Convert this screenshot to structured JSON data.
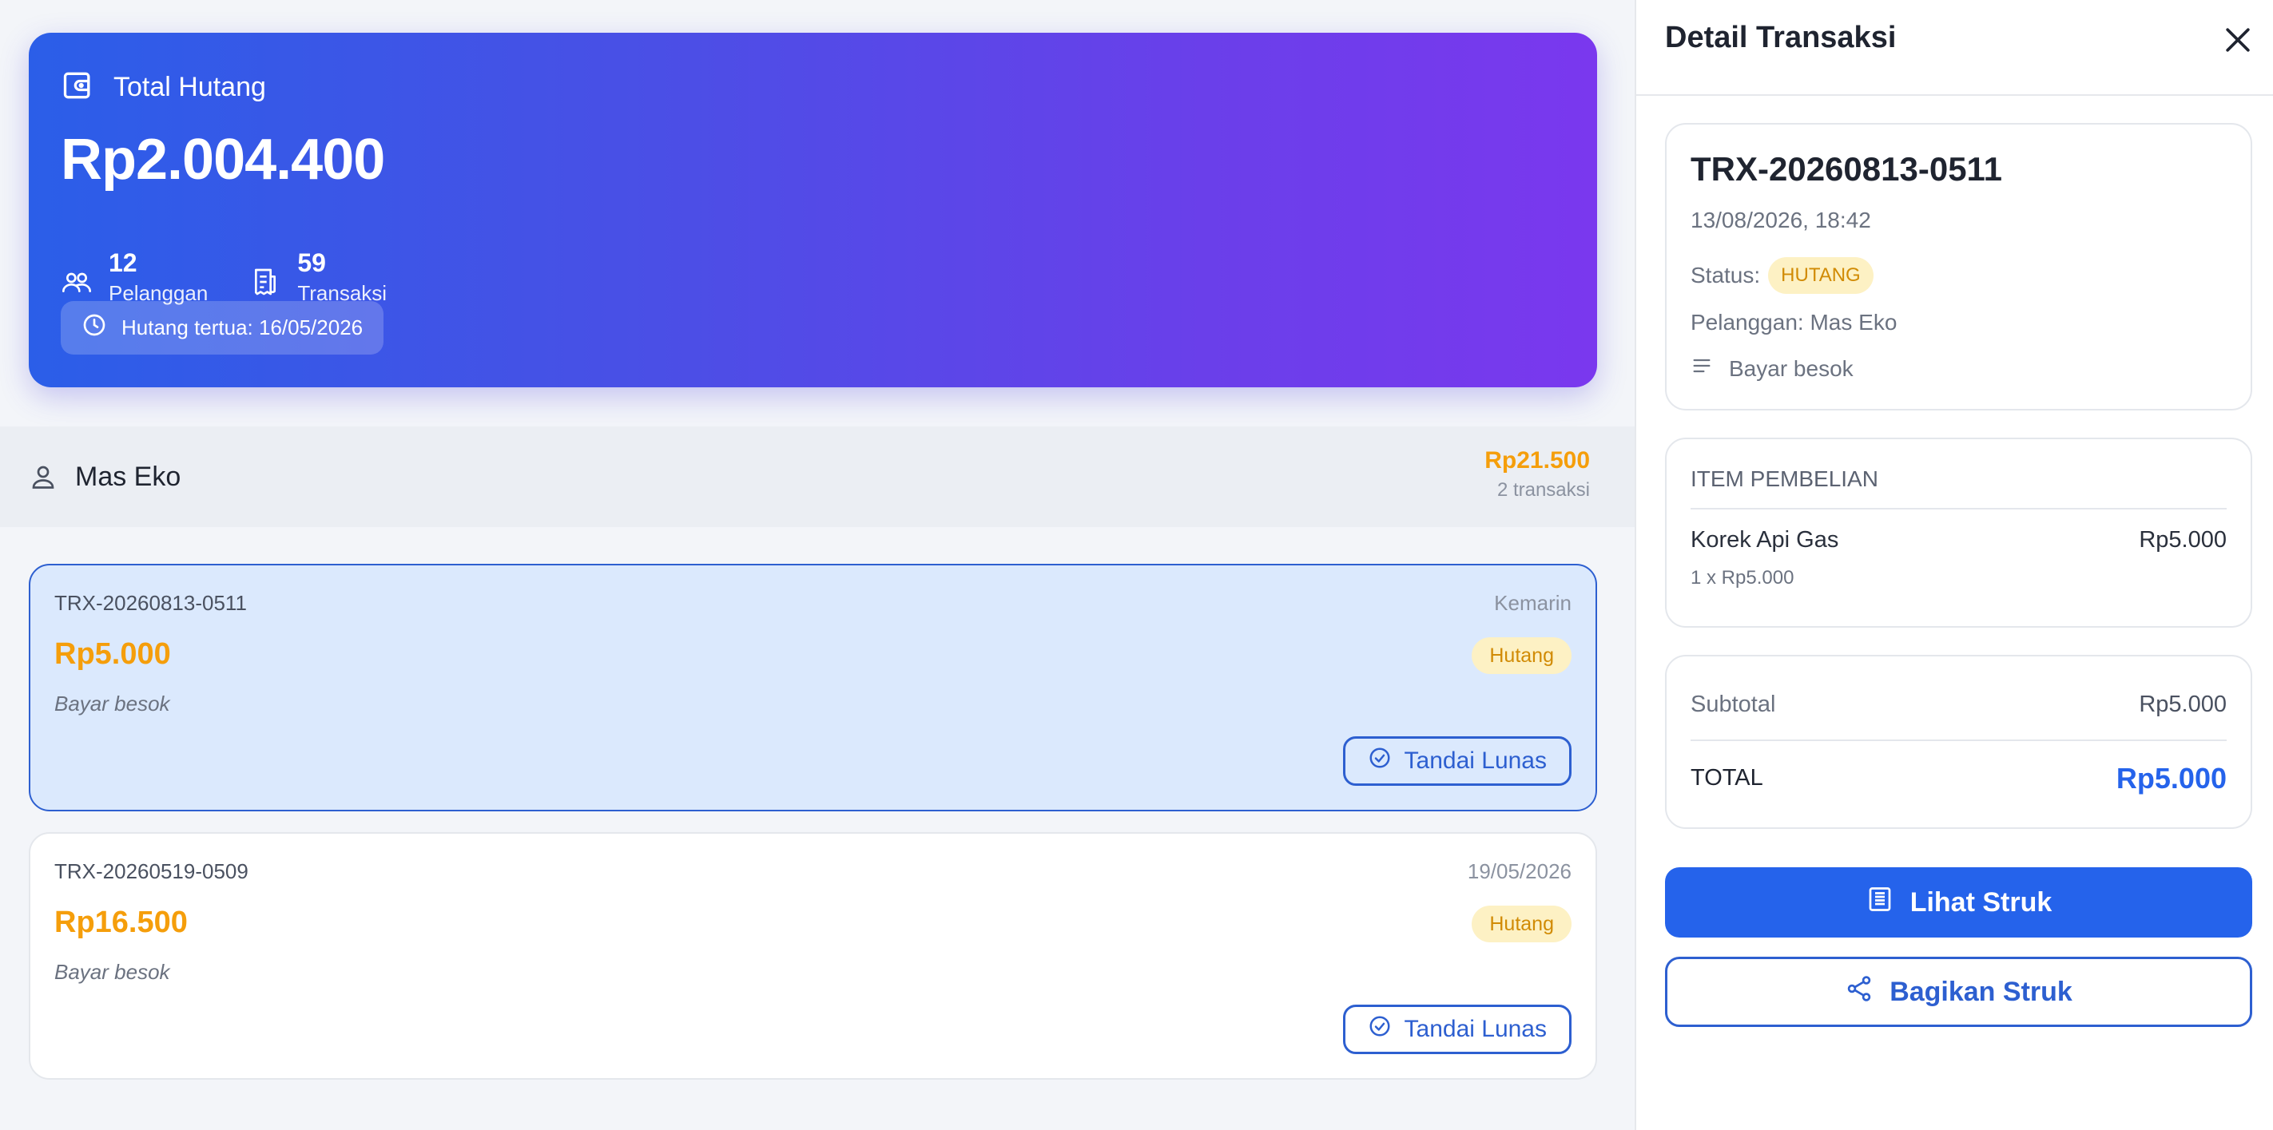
{
  "summary": {
    "title": "Total Hutang",
    "amount": "Rp2.004.400",
    "customers_count": "12",
    "customers_label": "Pelanggan",
    "transactions_count": "59",
    "transactions_label": "Transaksi",
    "oldest_debt": "Hutang tertua: 16/05/2026"
  },
  "customer": {
    "name": "Mas Eko",
    "total": "Rp21.500",
    "count": "2 transaksi"
  },
  "transactions": [
    {
      "id": "TRX-20260813-0511",
      "date": "Kemarin",
      "amount": "Rp5.000",
      "status": "Hutang",
      "note": "Bayar besok",
      "action": "Tandai Lunas"
    },
    {
      "id": "TRX-20260519-0509",
      "date": "19/05/2026",
      "amount": "Rp16.500",
      "status": "Hutang",
      "note": "Bayar besok",
      "action": "Tandai Lunas"
    }
  ],
  "detail": {
    "title": "Detail Transaksi",
    "id": "TRX-20260813-0511",
    "datetime": "13/08/2026, 18:42",
    "status_label": "Status:",
    "status_value": "HUTANG",
    "customer": "Pelanggan: Mas Eko",
    "note": "Bayar besok",
    "items_title": "ITEM PEMBELIAN",
    "items": [
      {
        "name": "Korek Api Gas",
        "price": "Rp5.000",
        "qty": "1 x Rp5.000"
      }
    ],
    "subtotal_label": "Subtotal",
    "subtotal_value": "Rp5.000",
    "total_label": "TOTAL",
    "total_value": "Rp5.000",
    "view_receipt": "Lihat Struk",
    "share_receipt": "Bagikan Struk"
  },
  "colors": {
    "accent": "#2563eb",
    "debt": "#f59e0b",
    "badge_bg": "#fdf1c4",
    "gradient_start": "#2b5ee8",
    "gradient_end": "#7a38ee"
  },
  "icons": {
    "summary": "wallet-icon",
    "customers": "users-icon",
    "transactions": "receipt-icon",
    "oldest": "clock-icon",
    "customer": "person-icon",
    "lunas": "check-circle-icon",
    "close": "close-icon",
    "note": "lines-icon",
    "view": "receipt-icon",
    "share": "share-icon"
  }
}
